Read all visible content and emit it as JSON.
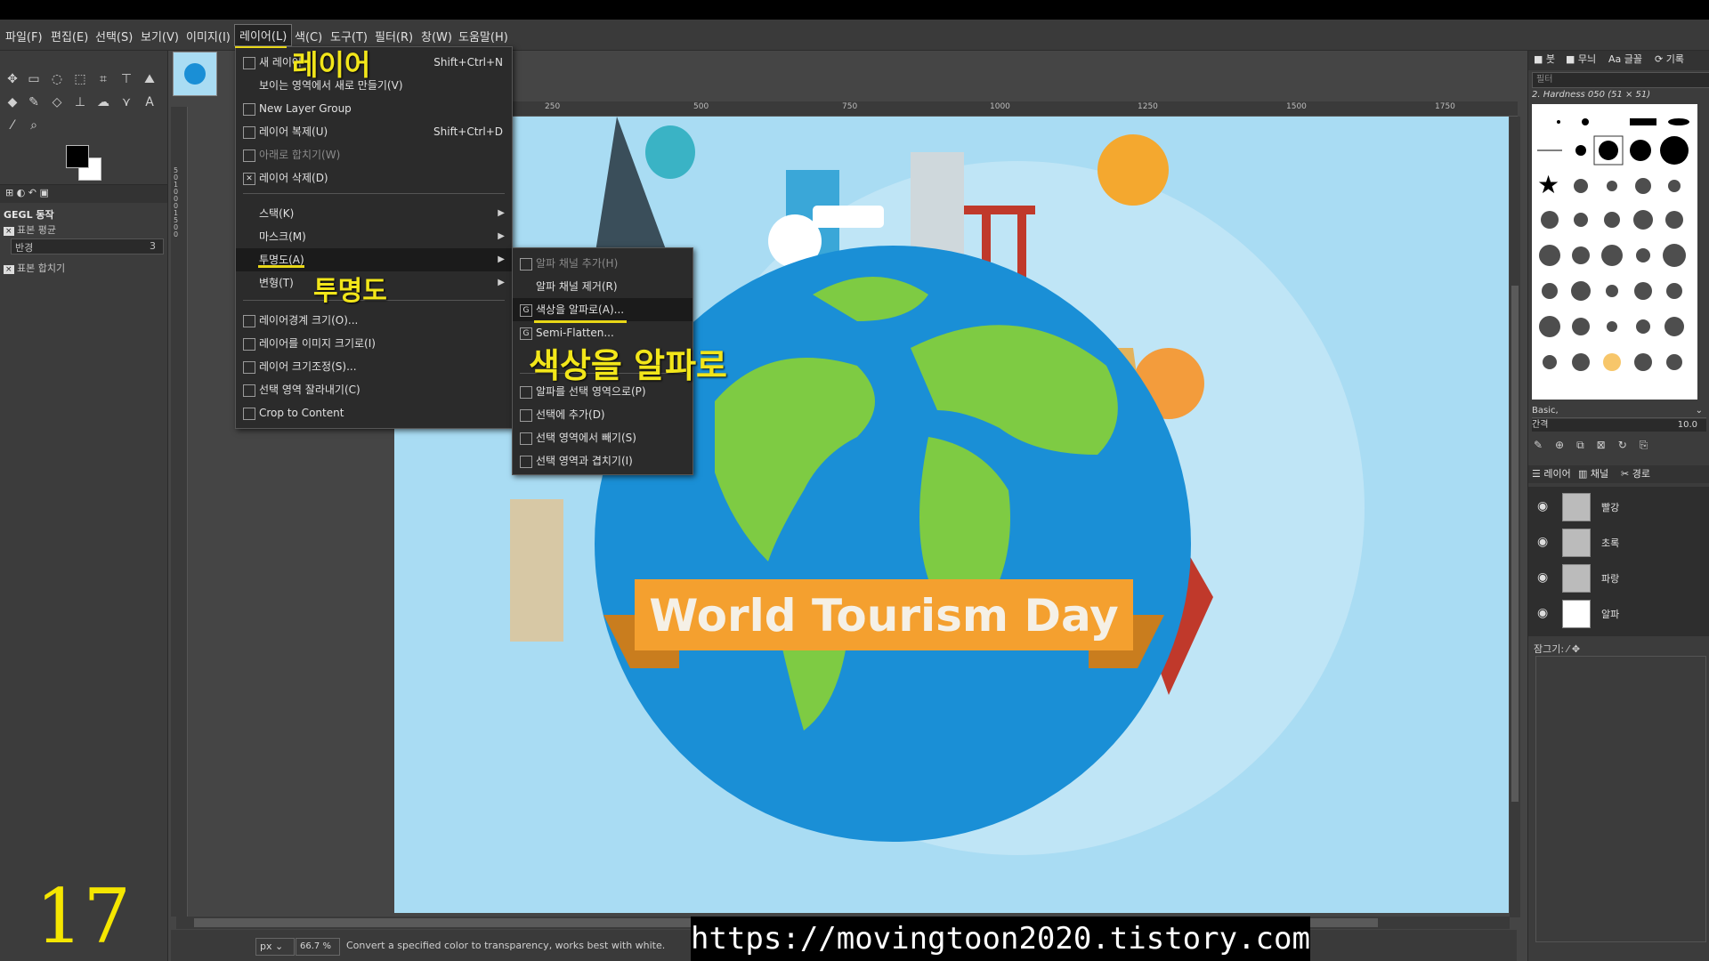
{
  "menubar": [
    "파일(F)",
    "편집(E)",
    "선택(S)",
    "보기(V)",
    "이미지(I)",
    "레이어(L)",
    "색(C)",
    "도구(T)",
    "필터(R)",
    "창(W)",
    "도움말(H)"
  ],
  "active_menu": "레이어(L)",
  "layer_menu": {
    "items": [
      {
        "label": "새 레이어",
        "shortcut": "Shift+Ctrl+N"
      },
      {
        "label": "보이는 영역에서 새로 만들기(V)",
        "shortcut": ""
      },
      {
        "label": "New Layer Group",
        "shortcut": ""
      },
      {
        "label": "레이어 복제(U)",
        "shortcut": "Shift+Ctrl+D"
      },
      {
        "label": "아래로 합치기(W)",
        "shortcut": ""
      },
      {
        "label": "레이어 삭제(D)",
        "shortcut": ""
      },
      {
        "label": "스택(K)",
        "shortcut": ""
      },
      {
        "label": "마스크(M)",
        "shortcut": ""
      },
      {
        "label": "투명도(A)",
        "shortcut": ""
      },
      {
        "label": "변형(T)",
        "shortcut": ""
      },
      {
        "label": "레이어경계 크기(O)...",
        "shortcut": ""
      },
      {
        "label": "레이어를 이미지 크기로(I)",
        "shortcut": ""
      },
      {
        "label": "레이어 크기조정(S)...",
        "shortcut": ""
      },
      {
        "label": "선택 영역 잘라내기(C)",
        "shortcut": ""
      },
      {
        "label": "Crop to Content",
        "shortcut": ""
      }
    ]
  },
  "transparency_submenu": {
    "items": [
      {
        "label": "알파 채널 추가(H)"
      },
      {
        "label": "알파 채널 제거(R)"
      },
      {
        "label": "색상을 알파로(A)..."
      },
      {
        "label": "Semi-Flatten..."
      },
      {
        "label": "알파를 선택 영역으로(P)"
      },
      {
        "label": "선택에 추가(D)"
      },
      {
        "label": "선택 영역에서 빼기(S)"
      },
      {
        "label": "선택 영역과 겹치기(I)"
      }
    ]
  },
  "annotations": {
    "layer": "레이어",
    "transparency": "투명도",
    "color_to_alpha": "색상을 알파로"
  },
  "left_dock": {
    "panel_title": "GEGL 동작",
    "row1": "표본 평균",
    "radius_label": "반경",
    "radius_value": "3",
    "row2": "표본 합치기"
  },
  "ruler": [
    "250",
    "500",
    "750",
    "1000",
    "1250",
    "1500",
    "1750"
  ],
  "ruler_v": [
    "5",
    "0",
    "1",
    "0",
    "0",
    "0",
    "1",
    "5",
    "0",
    "0"
  ],
  "canvas": {
    "banner_text": "World Tourism Day"
  },
  "right_dock": {
    "tabs": [
      "붓",
      "무늬",
      "글꼴",
      "기록"
    ],
    "filter_placeholder": "필터",
    "brush_name": "2. Hardness 050 (51 × 51)",
    "brush_preset": "Basic,",
    "spacing_label": "간격",
    "spacing_value": "10.0",
    "layer_tabs": [
      "레이어",
      "채널",
      "경로"
    ],
    "layers": [
      "빨강",
      "초록",
      "파랑",
      "알파"
    ],
    "lock_label": "잠그기:"
  },
  "statusbar": {
    "unit": "px",
    "zoom": "66.7 %",
    "message": "Convert a specified color to transparency, works best with white."
  },
  "url": "https://movingtoon2020.tistory.com",
  "slide_number": "17",
  "colors": {
    "sky": "#a9dcf3",
    "ocean": "#1a8fd6",
    "land": "#7ecb43",
    "banner": "#f4a02f",
    "annotation": "#f2e61a"
  }
}
